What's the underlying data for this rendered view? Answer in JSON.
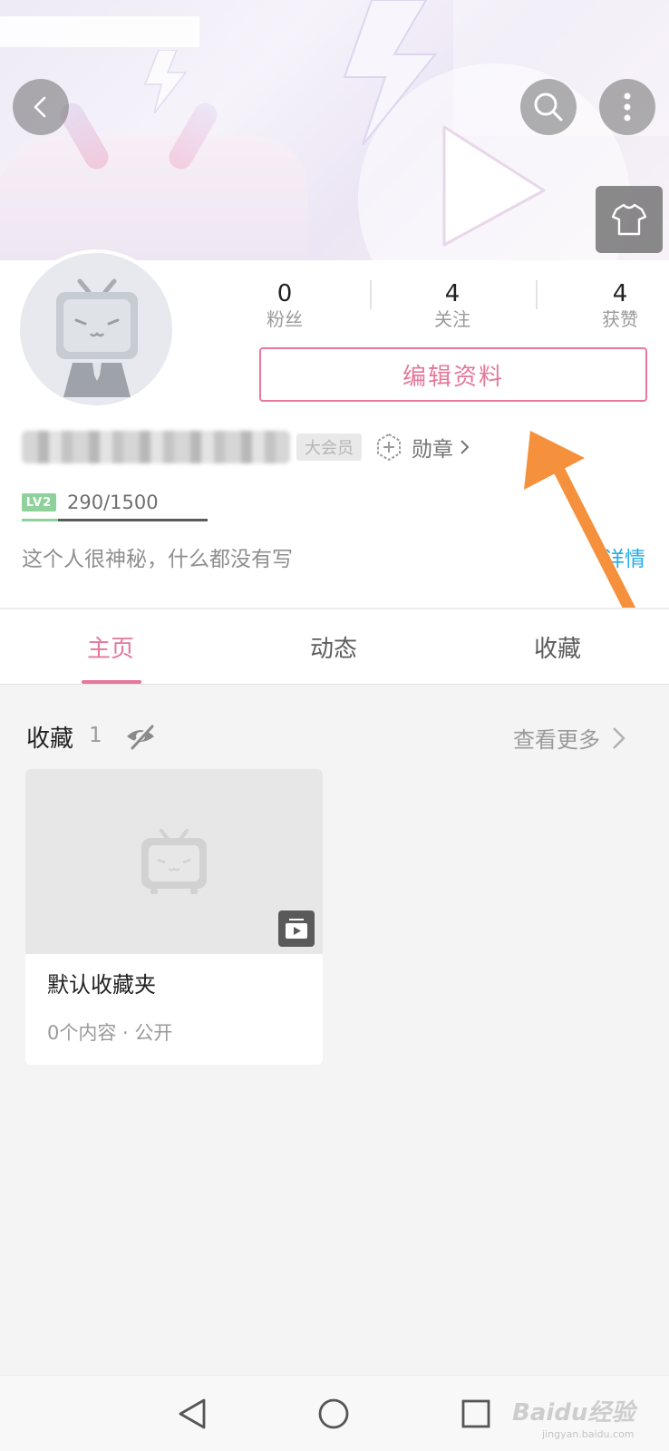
{
  "stats": {
    "fans": {
      "value": "0",
      "label": "粉丝"
    },
    "following": {
      "value": "4",
      "label": "关注"
    },
    "likes": {
      "value": "4",
      "label": "获赞"
    }
  },
  "edit_profile_label": "编辑资料",
  "vip_badge": "大会员",
  "medal_label": "勋章",
  "level": {
    "badge": "LV2",
    "exp_text": "290/1500",
    "progress": 0.193
  },
  "bio": "这个人很神秘，什么都没有写",
  "details_link": "详情",
  "tabs": [
    {
      "label": "主页",
      "active": true
    },
    {
      "label": "动态",
      "active": false
    },
    {
      "label": "收藏",
      "active": false
    }
  ],
  "favorites": {
    "title": "收藏",
    "count": "1",
    "more_label": "查看更多",
    "folder": {
      "name": "默认收藏夹",
      "meta": "0个内容 · 公开"
    }
  },
  "watermark": {
    "main": "Baidu经验",
    "sub": "jingyan.baidu.com"
  },
  "colors": {
    "accent_pink": "#e4779a",
    "link_blue": "#23ade5",
    "level_green": "#8ed19b",
    "annotation_orange": "#f5903d"
  },
  "icons": [
    "back-icon",
    "search-icon",
    "more-icon",
    "theme-shirt-icon",
    "medal-icon",
    "eye-off-icon",
    "chevron-right-icon",
    "folder-play-icon",
    "nav-back-icon",
    "nav-home-icon",
    "nav-recent-icon"
  ]
}
